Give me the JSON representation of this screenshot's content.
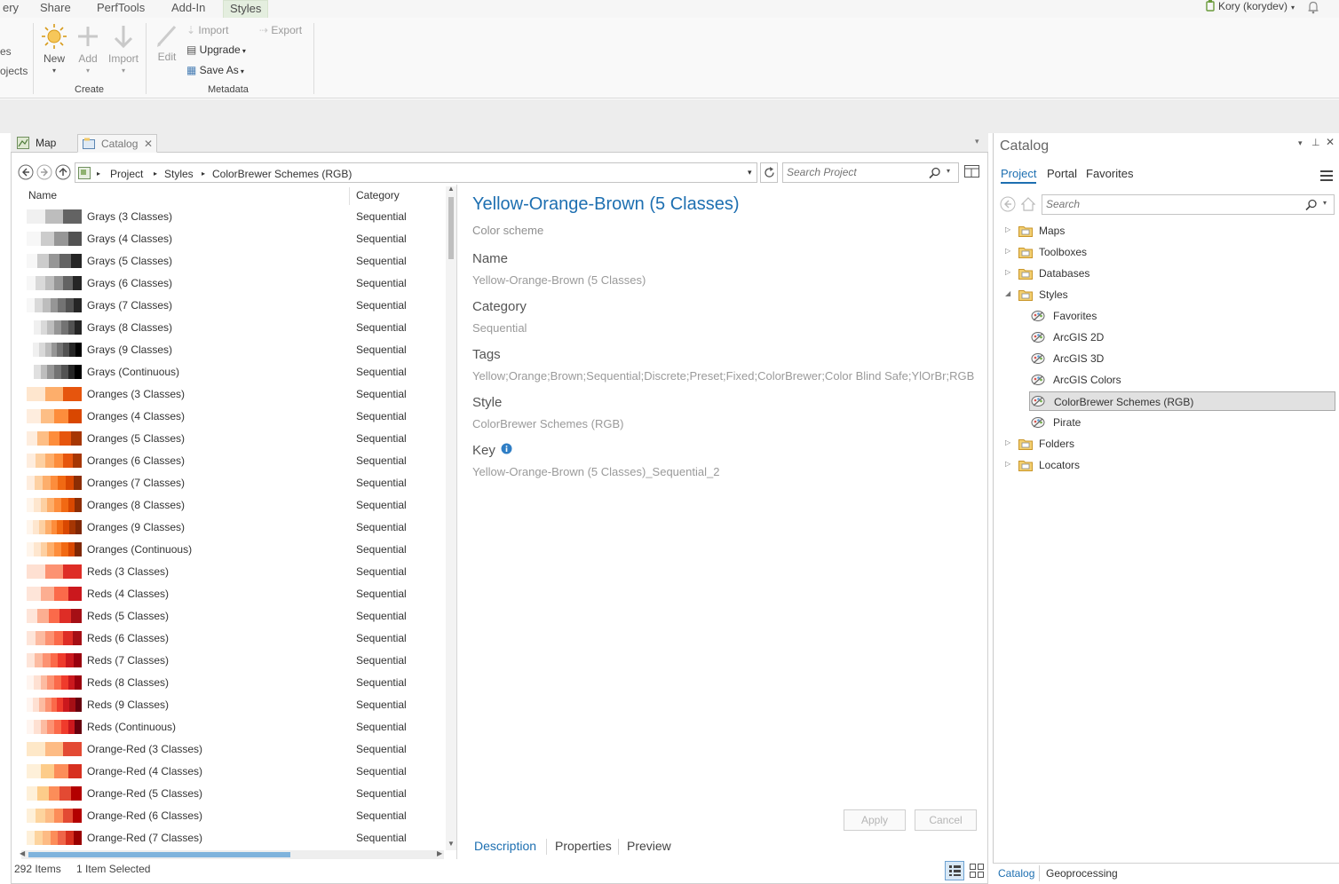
{
  "ribbon": {
    "tabs": [
      "ery",
      "Share",
      "PerfTools",
      "Add-In",
      "Styles"
    ],
    "user": "Kory (korydev)",
    "left_cut": [
      "es",
      "ojects"
    ],
    "create": {
      "new": "New",
      "add": "Add",
      "import": "Import",
      "group": "Create"
    },
    "metadata": {
      "edit": "Edit",
      "import": "Import",
      "export": "Export",
      "upgrade": "Upgrade",
      "save_as": "Save As",
      "group": "Metadata"
    }
  },
  "view_tabs": {
    "map": "Map",
    "catalog": "Catalog"
  },
  "breadcrumb": [
    "Project",
    "Styles",
    "ColorBrewer Schemes (RGB)"
  ],
  "search_project": {
    "placeholder": "Search Project"
  },
  "list": {
    "headers": {
      "name": "Name",
      "category": "Category"
    },
    "rows": [
      {
        "name": "Grays (3 Classes)",
        "category": "Sequential",
        "colors": [
          "#f0f0f0",
          "#bdbdbd",
          "#636363"
        ]
      },
      {
        "name": "Grays (4 Classes)",
        "category": "Sequential",
        "colors": [
          "#f7f7f7",
          "#cccccc",
          "#969696",
          "#525252"
        ]
      },
      {
        "name": "Grays (5 Classes)",
        "category": "Sequential",
        "colors": [
          "#f7f7f7",
          "#cccccc",
          "#969696",
          "#636363",
          "#252525"
        ]
      },
      {
        "name": "Grays (6 Classes)",
        "category": "Sequential",
        "colors": [
          "#f7f7f7",
          "#d9d9d9",
          "#bdbdbd",
          "#969696",
          "#636363",
          "#252525"
        ]
      },
      {
        "name": "Grays (7 Classes)",
        "category": "Sequential",
        "colors": [
          "#f7f7f7",
          "#d9d9d9",
          "#bdbdbd",
          "#969696",
          "#737373",
          "#525252",
          "#252525"
        ]
      },
      {
        "name": "Grays (8 Classes)",
        "category": "Sequential",
        "colors": [
          "#ffffff",
          "#f0f0f0",
          "#d9d9d9",
          "#bdbdbd",
          "#969696",
          "#737373",
          "#525252",
          "#252525"
        ]
      },
      {
        "name": "Grays (9 Classes)",
        "category": "Sequential",
        "colors": [
          "#ffffff",
          "#f0f0f0",
          "#d9d9d9",
          "#bdbdbd",
          "#969696",
          "#737373",
          "#525252",
          "#252525",
          "#000000"
        ]
      },
      {
        "name": "Grays (Continuous)",
        "category": "Sequential",
        "colors": [
          "#ffffff",
          "#e0e0e0",
          "#bdbdbd",
          "#969696",
          "#737373",
          "#525252",
          "#252525",
          "#000000"
        ]
      },
      {
        "name": "Oranges (3 Classes)",
        "category": "Sequential",
        "colors": [
          "#fee6ce",
          "#fdae6b",
          "#e6550d"
        ]
      },
      {
        "name": "Oranges (4 Classes)",
        "category": "Sequential",
        "colors": [
          "#feedde",
          "#fdbe85",
          "#fd8d3c",
          "#d94701"
        ]
      },
      {
        "name": "Oranges (5 Classes)",
        "category": "Sequential",
        "colors": [
          "#feedde",
          "#fdbe85",
          "#fd8d3c",
          "#e6550d",
          "#a63603"
        ]
      },
      {
        "name": "Oranges (6 Classes)",
        "category": "Sequential",
        "colors": [
          "#feedde",
          "#fdd0a2",
          "#fdae6b",
          "#fd8d3c",
          "#e6550d",
          "#a63603"
        ]
      },
      {
        "name": "Oranges (7 Classes)",
        "category": "Sequential",
        "colors": [
          "#feedde",
          "#fdd0a2",
          "#fdae6b",
          "#fd8d3c",
          "#f16913",
          "#d94801",
          "#8c2d04"
        ]
      },
      {
        "name": "Oranges (8 Classes)",
        "category": "Sequential",
        "colors": [
          "#fff5eb",
          "#fee6ce",
          "#fdd0a2",
          "#fdae6b",
          "#fd8d3c",
          "#f16913",
          "#d94801",
          "#8c2d04"
        ]
      },
      {
        "name": "Oranges (9 Classes)",
        "category": "Sequential",
        "colors": [
          "#fff5eb",
          "#fee6ce",
          "#fdd0a2",
          "#fdae6b",
          "#fd8d3c",
          "#f16913",
          "#d94801",
          "#a63603",
          "#7f2704"
        ]
      },
      {
        "name": "Oranges (Continuous)",
        "category": "Sequential",
        "colors": [
          "#fff5eb",
          "#fee6ce",
          "#fdd0a2",
          "#fdae6b",
          "#fd8d3c",
          "#f16913",
          "#d94801",
          "#7f2704"
        ]
      },
      {
        "name": "Reds (3 Classes)",
        "category": "Sequential",
        "colors": [
          "#fee0d2",
          "#fc9272",
          "#de2d26"
        ]
      },
      {
        "name": "Reds (4 Classes)",
        "category": "Sequential",
        "colors": [
          "#fee5d9",
          "#fcae91",
          "#fb6a4a",
          "#cb181d"
        ]
      },
      {
        "name": "Reds (5 Classes)",
        "category": "Sequential",
        "colors": [
          "#fee5d9",
          "#fcae91",
          "#fb6a4a",
          "#de2d26",
          "#a50f15"
        ]
      },
      {
        "name": "Reds (6 Classes)",
        "category": "Sequential",
        "colors": [
          "#fee5d9",
          "#fcbba1",
          "#fc9272",
          "#fb6a4a",
          "#de2d26",
          "#a50f15"
        ]
      },
      {
        "name": "Reds (7 Classes)",
        "category": "Sequential",
        "colors": [
          "#fee5d9",
          "#fcbba1",
          "#fc9272",
          "#fb6a4a",
          "#ef3b2c",
          "#cb181d",
          "#99000d"
        ]
      },
      {
        "name": "Reds (8 Classes)",
        "category": "Sequential",
        "colors": [
          "#fff5f0",
          "#fee0d2",
          "#fcbba1",
          "#fc9272",
          "#fb6a4a",
          "#ef3b2c",
          "#cb181d",
          "#99000d"
        ]
      },
      {
        "name": "Reds (9 Classes)",
        "category": "Sequential",
        "colors": [
          "#fff5f0",
          "#fee0d2",
          "#fcbba1",
          "#fc9272",
          "#fb6a4a",
          "#ef3b2c",
          "#cb181d",
          "#a50f15",
          "#67000d"
        ]
      },
      {
        "name": "Reds (Continuous)",
        "category": "Sequential",
        "colors": [
          "#fff5f0",
          "#fee0d2",
          "#fcbba1",
          "#fc9272",
          "#fb6a4a",
          "#ef3b2c",
          "#cb181d",
          "#67000d"
        ]
      },
      {
        "name": "Orange-Red (3 Classes)",
        "category": "Sequential",
        "colors": [
          "#fee8c8",
          "#fdbb84",
          "#e34a33"
        ]
      },
      {
        "name": "Orange-Red (4 Classes)",
        "category": "Sequential",
        "colors": [
          "#fef0d9",
          "#fdcc8a",
          "#fc8d59",
          "#d7301f"
        ]
      },
      {
        "name": "Orange-Red (5 Classes)",
        "category": "Sequential",
        "colors": [
          "#fef0d9",
          "#fdcc8a",
          "#fc8d59",
          "#e34a33",
          "#b30000"
        ]
      },
      {
        "name": "Orange-Red (6 Classes)",
        "category": "Sequential",
        "colors": [
          "#fef0d9",
          "#fdd49e",
          "#fdbb84",
          "#fc8d59",
          "#e34a33",
          "#b30000"
        ]
      },
      {
        "name": "Orange-Red (7 Classes)",
        "category": "Sequential",
        "colors": [
          "#fef0d9",
          "#fdd49e",
          "#fdbb84",
          "#fc8d59",
          "#ef6548",
          "#d7301f",
          "#990000"
        ]
      }
    ],
    "scroll_fraction": 0.62
  },
  "status": {
    "items": "292 Items",
    "selected": "1 Item Selected"
  },
  "details": {
    "title": "Yellow-Orange-Brown (5 Classes)",
    "subtitle": "Color scheme",
    "name_label": "Name",
    "name": "Yellow-Orange-Brown (5 Classes)",
    "category_label": "Category",
    "category": "Sequential",
    "tags_label": "Tags",
    "tags": "Yellow;Orange;Brown;Sequential;Discrete;Preset;Fixed;ColorBrewer;Color Blind Safe;YlOrBr;RGB",
    "style_label": "Style",
    "style": "ColorBrewer Schemes (RGB)",
    "key_label": "Key",
    "key": "Yellow-Orange-Brown (5 Classes)_Sequential_2",
    "apply": "Apply",
    "cancel": "Cancel",
    "tabs": [
      "Description",
      "Properties",
      "Preview"
    ]
  },
  "catalog": {
    "title": "Catalog",
    "tabs": [
      "Project",
      "Portal",
      "Favorites"
    ],
    "search": {
      "placeholder": "Search"
    },
    "tree": [
      {
        "label": "Maps",
        "level": 0,
        "caret": "right"
      },
      {
        "label": "Toolboxes",
        "level": 0,
        "caret": "right"
      },
      {
        "label": "Databases",
        "level": 0,
        "caret": "right"
      },
      {
        "label": "Styles",
        "level": 0,
        "caret": "down"
      },
      {
        "label": "Favorites",
        "level": 1
      },
      {
        "label": "ArcGIS 2D",
        "level": 1
      },
      {
        "label": "ArcGIS 3D",
        "level": 1
      },
      {
        "label": "ArcGIS Colors",
        "level": 1
      },
      {
        "label": "ColorBrewer Schemes (RGB)",
        "level": 1,
        "selected": true
      },
      {
        "label": "Pirate",
        "level": 1
      },
      {
        "label": "Folders",
        "level": 0,
        "caret": "right"
      },
      {
        "label": "Locators",
        "level": 0,
        "caret": "right"
      }
    ],
    "bottom_tabs": [
      "Catalog",
      "Geoprocessing"
    ]
  },
  "colors": {
    "accent": "#1d6fb1",
    "ribbon_active": "#e4eedf",
    "selection": "#e1e1e1"
  }
}
